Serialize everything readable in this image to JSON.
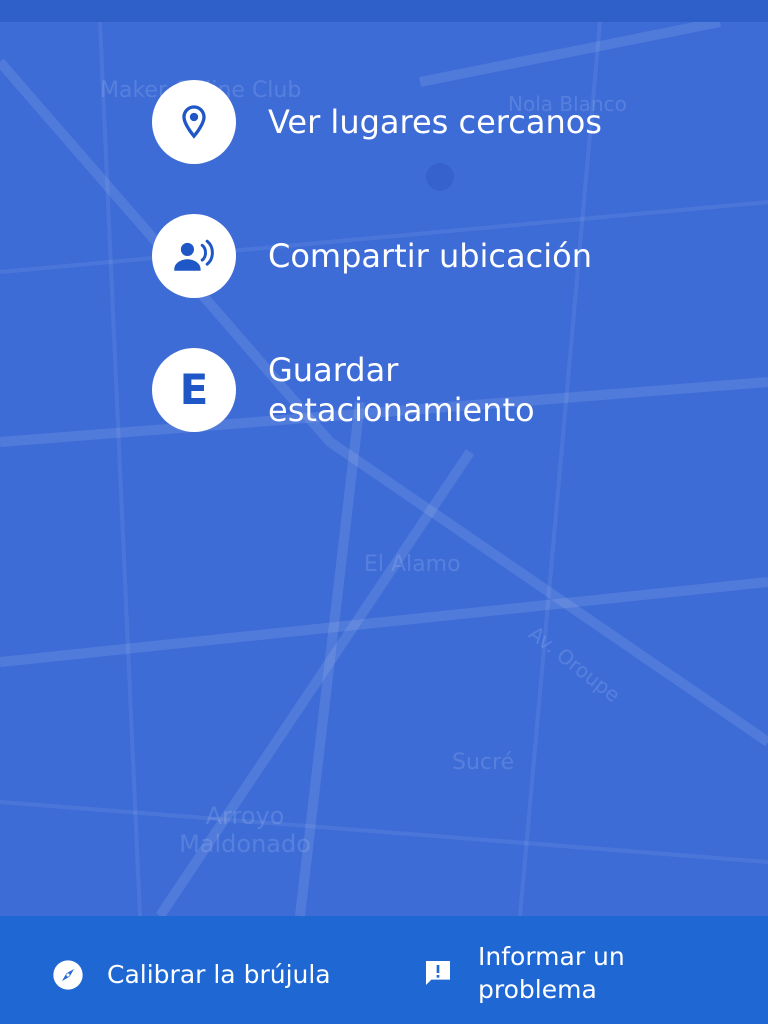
{
  "menu": {
    "items": [
      {
        "label": "Ver lugares cercanos",
        "icon": "place-pin-icon"
      },
      {
        "label": "Compartir ubicación",
        "icon": "share-location-person-icon"
      },
      {
        "label": "Guardar estacionamiento",
        "icon": "parking-e-icon",
        "letter": "E"
      }
    ]
  },
  "map": {
    "labels": [
      "Maker Online Club",
      "Nola Blanco",
      "El Alamo",
      "Av. Oroupe",
      "Sucré",
      "Arroyo Maldonado"
    ]
  },
  "bottom_bar": {
    "calibrate_label": "Calibrar la brújula",
    "report_label": "Informar un problema"
  },
  "colors": {
    "overlay": "#3e6cd7",
    "bottom_bar": "#1f68d3",
    "icon_blue": "#1f58c6"
  }
}
